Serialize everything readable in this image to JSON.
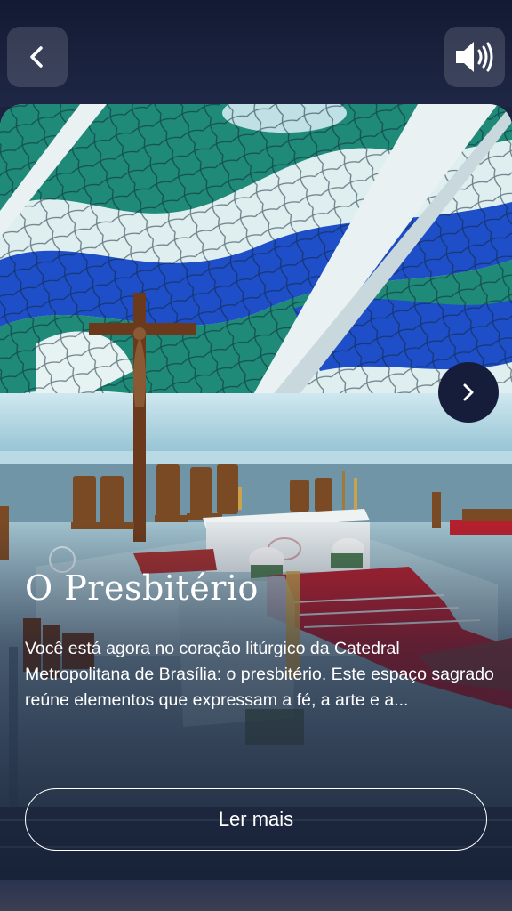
{
  "header": {
    "back_icon": "chevron-left-icon",
    "sound_icon": "speaker-volume-icon"
  },
  "card": {
    "title": "O Presbitério",
    "description": "Você está agora no coração litúrgico da Catedral Metropolitana de Brasília: o presbitério. Este espaço sagrado reúne elementos que expressam a fé, a arte e a...",
    "read_more_label": "Ler mais",
    "next_icon": "chevron-right-icon"
  },
  "colors": {
    "background": "#1b2340",
    "button_dark": "#151d3a",
    "stained_glass_blue": "#1f4fc8",
    "stained_glass_green": "#1f8a78",
    "carpet_red": "#b5202e"
  }
}
